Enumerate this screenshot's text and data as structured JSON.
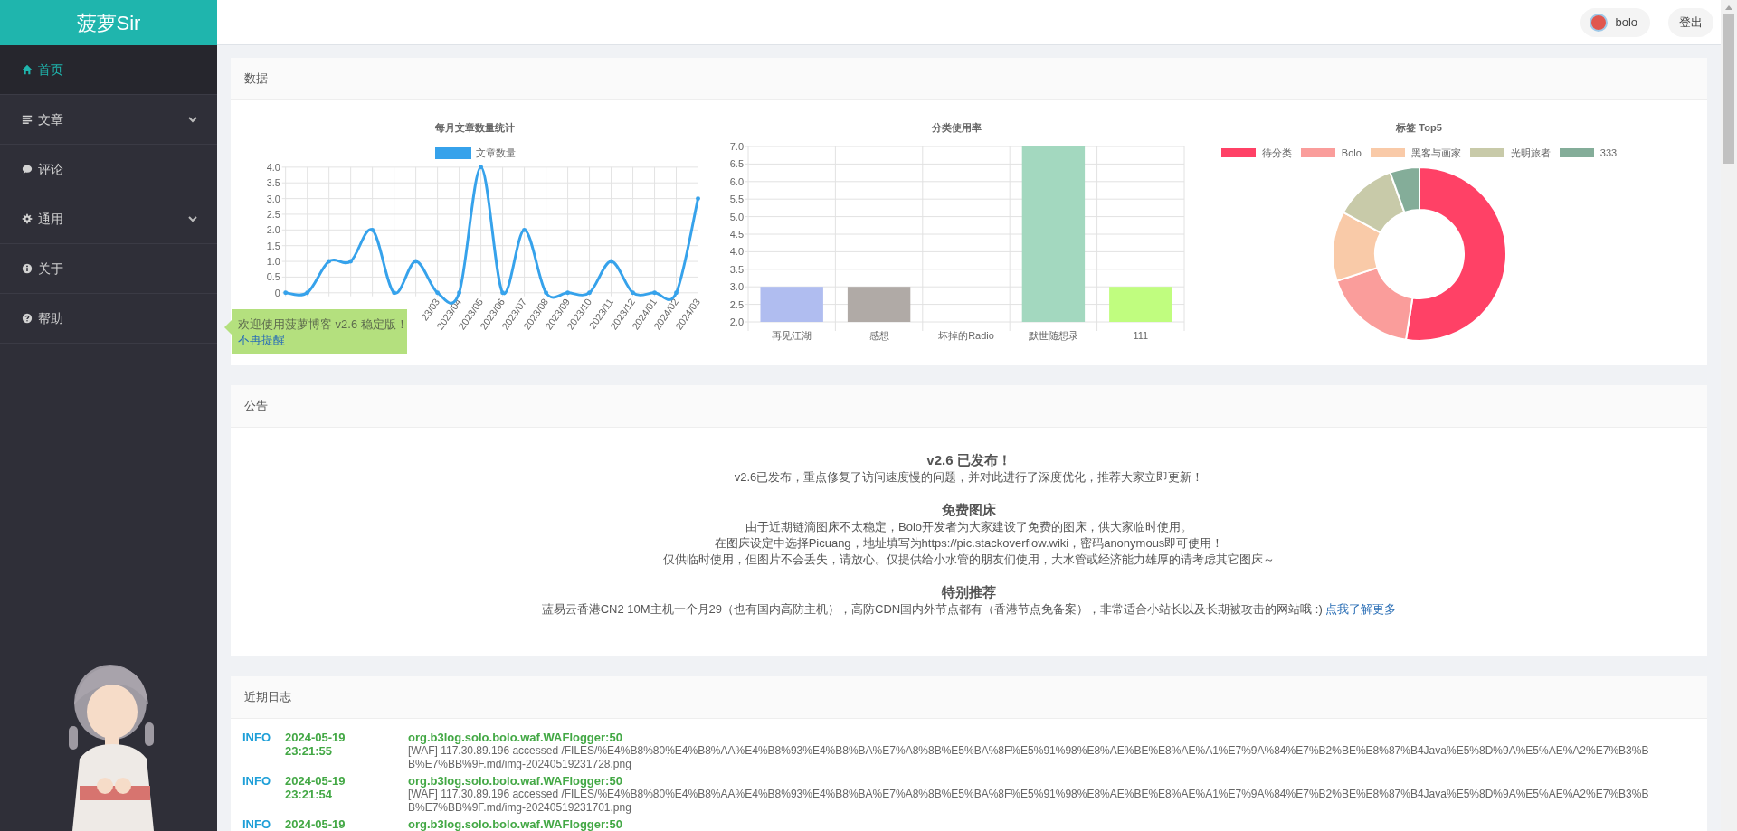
{
  "sidebar": {
    "logo": "菠萝Sir",
    "items": [
      {
        "label": "首页",
        "selected": true,
        "expandable": false
      },
      {
        "label": "文章",
        "selected": false,
        "expandable": true
      },
      {
        "label": "评论",
        "selected": false,
        "expandable": false
      },
      {
        "label": "通用",
        "selected": false,
        "expandable": true
      },
      {
        "label": "关于",
        "selected": false,
        "expandable": false
      },
      {
        "label": "帮助",
        "selected": false,
        "expandable": false
      }
    ]
  },
  "top_bar": {
    "user": "bolo",
    "logout": "登出"
  },
  "notice_popup": {
    "text": "欢迎使用菠萝博客 v2.6 稳定版！",
    "link": "不再提醒"
  },
  "data_card": {
    "title": "数据",
    "line_chart": {
      "chart_data": {
        "type": "line",
        "title": "每月文章数量统计",
        "categories": [
          null,
          null,
          null,
          null,
          null,
          null,
          null,
          "23/03",
          "2023/04",
          "2023/05",
          "2023/06",
          "2023/07",
          "2023/08",
          "2023/09",
          "2023/10",
          "2023/11",
          "2023/12",
          "2024/01",
          "2024/02",
          "2024/03"
        ],
        "series": [
          {
            "name": "文章数量",
            "color": "#36a2eb",
            "values": [
              0,
              0,
              1,
              1,
              2,
              0,
              1,
              0,
              0,
              4,
              0,
              2,
              0,
              0,
              0,
              1,
              0,
              0,
              0,
              3
            ]
          }
        ],
        "grid": true,
        "ylim": [
          0,
          4
        ],
        "yticks": [
          {
            "value": 0,
            "label": "0"
          },
          {
            "value": 0.5,
            "label": "0.5"
          },
          {
            "value": 1,
            "label": "1.0"
          },
          {
            "value": 1.5,
            "label": "1.5"
          },
          {
            "value": 2,
            "label": "2.0"
          },
          {
            "value": 2.5,
            "label": "2.5"
          },
          {
            "value": 3,
            "label": "3.0"
          },
          {
            "value": 3.5,
            "label": "3.5"
          },
          {
            "value": 4,
            "label": "4.0"
          }
        ]
      }
    },
    "bar_chart": {
      "chart_data": {
        "type": "bar",
        "title": "分类使用率",
        "categories": [
          "再见江湖",
          "感想",
          "坏掉的Radio",
          "默世随想录",
          "111"
        ],
        "values": [
          3,
          3,
          null,
          7,
          3
        ],
        "colors": [
          "#b0bdf0",
          "#b0aaa6",
          null,
          "#a3d8bf",
          "#c0fd7f"
        ],
        "grid": true,
        "ylim": [
          2,
          7
        ],
        "yticks": [
          {
            "value": 2,
            "label": "2.0"
          },
          {
            "value": 2.5,
            "label": "2.5"
          },
          {
            "value": 3,
            "label": "3.0"
          },
          {
            "value": 3.5,
            "label": "3.5"
          },
          {
            "value": 4,
            "label": "4.0"
          },
          {
            "value": 4.5,
            "label": "4.5"
          },
          {
            "value": 5,
            "label": "5.0"
          },
          {
            "value": 5.5,
            "label": "5.5"
          },
          {
            "value": 6,
            "label": "6.0"
          },
          {
            "value": 6.5,
            "label": "6.5"
          },
          {
            "value": 7,
            "label": "7.0"
          }
        ]
      }
    },
    "tag_chart": {
      "title": "标签 Top5",
      "legend": [
        {
          "label": "待分类",
          "color": "#ff4166"
        },
        {
          "label": "Bolo",
          "color": "#fa9d9b"
        },
        {
          "label": "黑客与画家",
          "color": "#f9caa8"
        },
        {
          "label": "光明旅者",
          "color": "#c8caa9"
        },
        {
          "label": "333",
          "color": "#84ad99"
        }
      ]
    }
  },
  "notice_card": {
    "title": "公告",
    "sections": [
      {
        "heading": "v2.6 已发布！",
        "lines": [
          {
            "text": "v2.6已发布，重点修复了访问速度慢的问题，并对此进行了深度优化，推荐大家立即更新！"
          }
        ]
      },
      {
        "heading": "免费图床",
        "lines": [
          {
            "text": "由于近期链滴图床不太稳定，Bolo开发者为大家建设了免费的图床，供大家临时使用。"
          },
          {
            "text": "在图床设定中选择Picuang，地址填写为https://pic.stackoverflow.wiki，密码anonymous即可使用！"
          },
          {
            "text": "仅供临时使用，但图片不会丢失，请放心。仅提供给小水管的朋友们使用，大水管或经济能力雄厚的请考虑其它图床～"
          }
        ]
      },
      {
        "heading": "特别推荐",
        "lines": [
          {
            "text": "蓝易云香港CN2 10M主机一个月29（也有国内高防主机），高防CDN国内外节点都有（香港节点免备案），非常适合小站长以及长期被攻击的网站哦 :) ",
            "link": "点我了解更多"
          }
        ]
      }
    ]
  },
  "log_card": {
    "title": "近期日志",
    "rows": [
      {
        "level": "INFO",
        "date": "2024-05-19",
        "time": "23:21:55",
        "logger": "org.b3log.solo.bolo.waf.WAFlogger:50",
        "message": "[WAF] 117.30.89.196 accessed /FILES/%E4%B8%80%E4%B8%AA%E4%B8%93%E4%B8%BA%E7%A8%8B%E5%BA%8F%E5%91%98%E8%AE%BE%E8%AE%A1%E7%9A%84%E7%B2%BE%E8%87%B4Java%E5%8D%9A%E5%AE%A2%E7%B3%BB%E7%BB%9F.md/img-20240519231728.png"
      },
      {
        "level": "INFO",
        "date": "2024-05-19",
        "time": "23:21:54",
        "logger": "org.b3log.solo.bolo.waf.WAFlogger:50",
        "message": "[WAF] 117.30.89.196 accessed /FILES/%E4%B8%80%E4%B8%AA%E4%B8%93%E4%B8%BA%E7%A8%8B%E5%BA%8F%E5%91%98%E8%AE%BE%E8%AE%A1%E7%9A%84%E7%B2%BE%E8%87%B4Java%E5%8D%9A%E5%AE%A2%E7%B3%BB%E7%BB%9F.md/img-20240519231701.png"
      },
      {
        "level": "INFO",
        "date": "2024-05-19",
        "logger": "org.b3log.solo.bolo.waf.WAFlogger:50"
      }
    ]
  }
}
